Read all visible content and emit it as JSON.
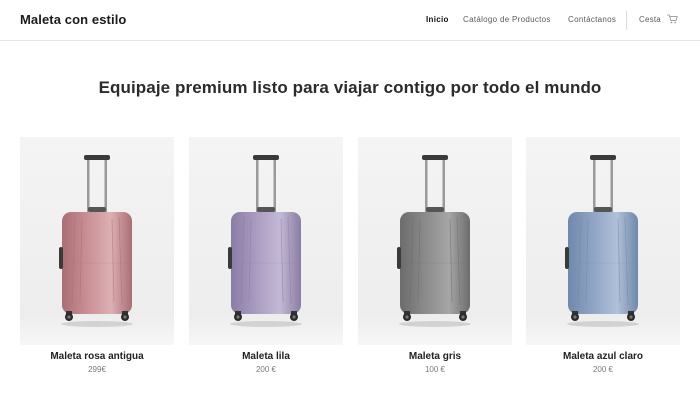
{
  "header": {
    "brand": "Maleta con estilo",
    "nav": [
      {
        "label": "Inicio",
        "active": true
      },
      {
        "label": "Catálogo de Productos",
        "active": false
      },
      {
        "label": "Contáctanos",
        "active": false
      }
    ],
    "cart_label": "Cesta",
    "cart_icon": "shopping-cart-icon"
  },
  "main": {
    "headline": "Equipaje premium listo para viajar contigo por todo el mundo"
  },
  "products": [
    {
      "name": "Maleta rosa antigua",
      "price": "299€",
      "color": "#c98e93",
      "dark": "#a86f74",
      "light": "#ddb0b4"
    },
    {
      "name": "Maleta lila",
      "price": "200 €",
      "color": "#a99bc0",
      "dark": "#8a7ca3",
      "light": "#c4b9d6"
    },
    {
      "name": "Maleta gris",
      "price": "100 €",
      "color": "#8a8a8a",
      "dark": "#6c6c6c",
      "light": "#a6a6a6"
    },
    {
      "name": "Maleta azul claro",
      "price": "200 €",
      "color": "#8fa4c4",
      "dark": "#7088ab",
      "light": "#b0c0d8"
    }
  ]
}
